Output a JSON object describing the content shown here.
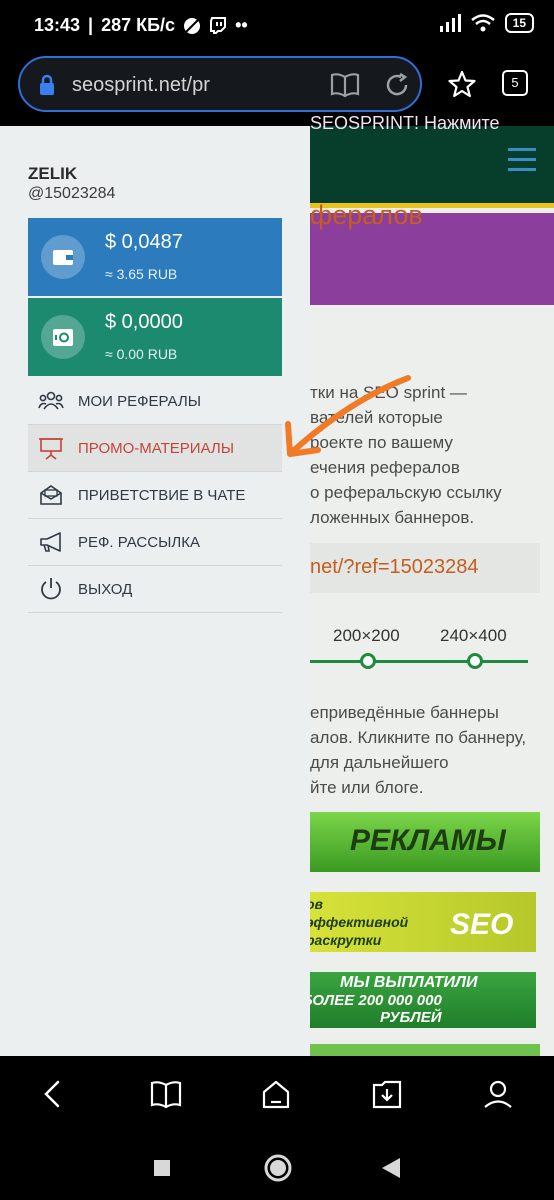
{
  "status_bar": {
    "time": "13:43",
    "speed": "287 КБ/с",
    "battery": "15"
  },
  "browser": {
    "url": "seosprint.net/pr",
    "tab_count": "5"
  },
  "background_page": {
    "banner_text": "SEOSPRINT! Нажмите",
    "heading": "фералов",
    "intro_lines": [
      "тки на SEO sprint —",
      "вателей которые",
      "роекте по вашему",
      "ечения рефералов",
      "о реферальскую ссылку",
      "ложенных баннеров."
    ],
    "ref_link": "net/?ref=15023284",
    "banner_sizes": [
      "200×200",
      "240×400"
    ],
    "banners_lines": [
      "еприведённые баннеры",
      "алов. Кликните по баннеру,",
      "для дальнейшего",
      "йте или блоге."
    ],
    "ad_banners": [
      {
        "text": "РЕКЛАМЫ"
      },
      {
        "text_lines": [
          "ов",
          "эффективной",
          "раскрутки"
        ],
        "extra": "SEO"
      },
      {
        "text_lines": [
          "МЫ ВЫПЛАТИЛИ",
          "БОЛЕЕ 200 000 000",
          "РУБЛЕЙ"
        ]
      }
    ]
  },
  "drawer": {
    "user_name": "ZELIK",
    "user_id": "@15023284",
    "balances": [
      {
        "amount": "$ 0,0487",
        "rub": "≈ 3.65 RUB",
        "icon": "wallet-icon",
        "color": "#2b7bbd"
      },
      {
        "amount": "$ 0,0000",
        "rub": "≈ 0.00 RUB",
        "icon": "safe-icon",
        "color": "#1b8a6e"
      }
    ],
    "menu": [
      {
        "label": "МОИ РЕФЕРАЛЫ",
        "icon": "users-icon",
        "active": false
      },
      {
        "label": "ПРОМО-МАТЕРИАЛЫ",
        "icon": "presentation-icon",
        "active": true
      },
      {
        "label": "ПРИВЕТСТВИЕ В ЧАТЕ",
        "icon": "mail-icon",
        "active": false
      },
      {
        "label": "РЕФ. РАССЫЛКА",
        "icon": "megaphone-icon",
        "active": false
      },
      {
        "label": "ВЫХОД",
        "icon": "power-icon",
        "active": false
      }
    ]
  },
  "colors": {
    "accent_orange": "#f07a26",
    "active_item_red": "#c44536",
    "header_green": "#063d2b"
  }
}
